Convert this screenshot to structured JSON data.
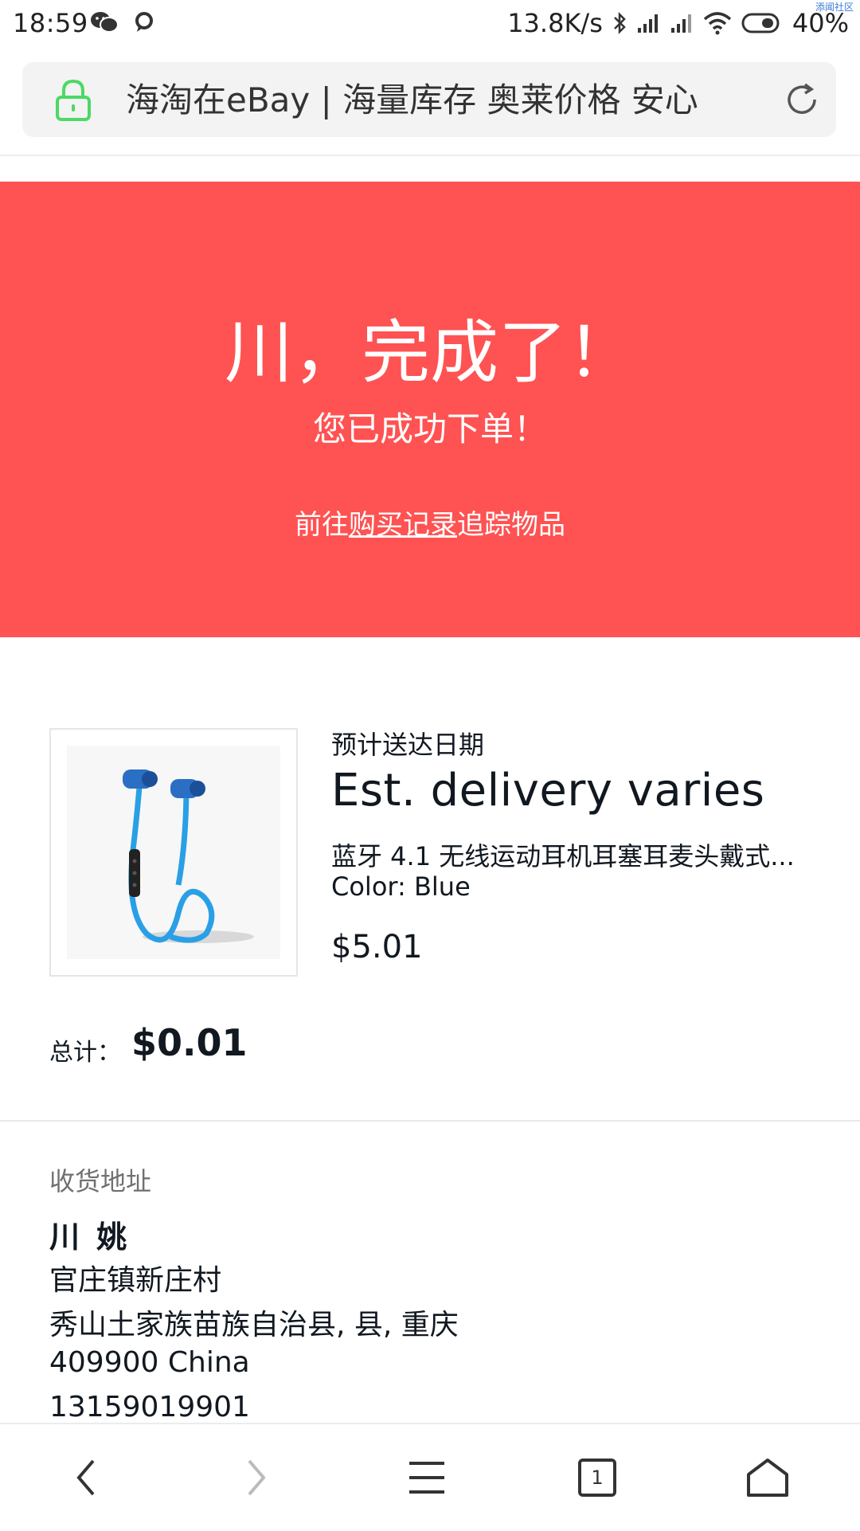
{
  "status_bar": {
    "time": "18:59",
    "network_speed": "13.8K/s",
    "battery": "40%",
    "watermark": "添闻社区"
  },
  "url_bar": {
    "title": "海淘在eBay | 海量库存 奥莱价格 安心"
  },
  "banner": {
    "title": "川，完成了！",
    "subtitle": "您已成功下单！",
    "link_prefix": "前往",
    "link_text": "购买记录",
    "link_suffix": "追踪物品",
    "background": "#ff5252"
  },
  "order": {
    "est_label": "预计送达日期",
    "est_value": "Est. delivery varies",
    "item_title": "蓝牙 4.1 无线运动耳机耳塞耳麦头戴式...",
    "item_color": "Color: Blue",
    "item_price": "$5.01",
    "total_label": "总计：",
    "total_value": "$0.01"
  },
  "address": {
    "label": "收货地址",
    "name": "川 姚",
    "line1": "官庄镇新庄村",
    "line2": "秀山土家族苗族自治县, 县, 重庆",
    "line3": "409900 China",
    "line4": "13159019901"
  },
  "bottom_nav": {
    "tab_count": "1"
  }
}
